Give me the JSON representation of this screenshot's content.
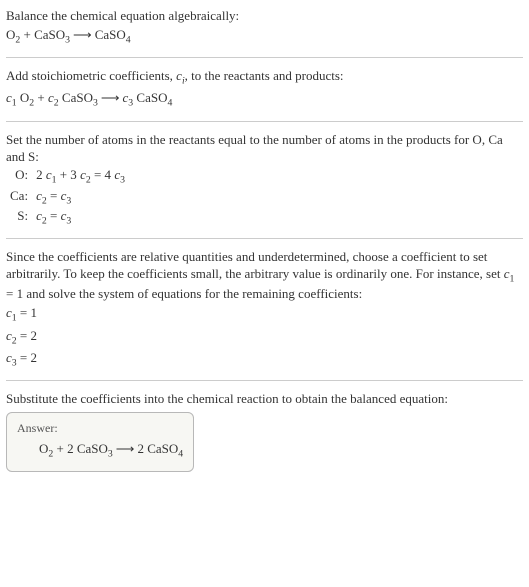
{
  "section1": {
    "title": "Balance the chemical equation algebraically:",
    "eq_lhs1": "O",
    "eq_lhs1_sub": "2",
    "eq_plus": " + ",
    "eq_lhs2": "CaSO",
    "eq_lhs2_sub": "3",
    "arrow": "⟶",
    "eq_rhs": "CaSO",
    "eq_rhs_sub": "4"
  },
  "section2": {
    "title_a": "Add stoichiometric coefficients, ",
    "title_ci_c": "c",
    "title_ci_i": "i",
    "title_b": ", to the reactants and products:",
    "c1": "c",
    "c1_sub": "1",
    "sp": " ",
    "O2": "O",
    "O2_sub": "2",
    "plus": " + ",
    "c2": "c",
    "c2_sub": "2",
    "CaSO3": "CaSO",
    "CaSO3_sub": "3",
    "arrow": "⟶",
    "c3": "c",
    "c3_sub": "3",
    "CaSO4": "CaSO",
    "CaSO4_sub": "4"
  },
  "section3": {
    "title": "Set the number of atoms in the reactants equal to the number of atoms in the products for O, Ca and S:",
    "rows": {
      "O_label": "O:",
      "O_eq_a": "2 ",
      "O_eq_c1": "c",
      "O_eq_c1_sub": "1",
      "O_eq_b": " + 3 ",
      "O_eq_c2": "c",
      "O_eq_c2_sub": "2",
      "O_eq_c": " = 4 ",
      "O_eq_c3": "c",
      "O_eq_c3_sub": "3",
      "Ca_label": "Ca:",
      "Ca_eq_c2": "c",
      "Ca_eq_c2_sub": "2",
      "Ca_eq_eq": " = ",
      "Ca_eq_c3": "c",
      "Ca_eq_c3_sub": "3",
      "S_label": "S:",
      "S_eq_c2": "c",
      "S_eq_c2_sub": "2",
      "S_eq_eq": " = ",
      "S_eq_c3": "c",
      "S_eq_c3_sub": "3"
    }
  },
  "section4": {
    "title_a": "Since the coefficients are relative quantities and underdetermined, choose a coefficient to set arbitrarily. To keep the coefficients small, the arbitrary value is ordinarily one. For instance, set ",
    "c1": "c",
    "c1_sub": "1",
    "title_b": " = 1 and solve the system of equations for the remaining coefficients:",
    "l1_c": "c",
    "l1_sub": "1",
    "l1_v": " = 1",
    "l2_c": "c",
    "l2_sub": "2",
    "l2_v": " = 2",
    "l3_c": "c",
    "l3_sub": "3",
    "l3_v": " = 2"
  },
  "section5": {
    "title": "Substitute the coefficients into the chemical reaction to obtain the balanced equation:",
    "answer_label": "Answer:",
    "O2": "O",
    "O2_sub": "2",
    "plus": " + 2 ",
    "CaSO3": "CaSO",
    "CaSO3_sub": "3",
    "arrow": "⟶",
    "rhs_pre": "2 ",
    "CaSO4": "CaSO",
    "CaSO4_sub": "4"
  },
  "chart_data": {
    "type": "table",
    "title": "Balanced chemical equation derivation",
    "unbalanced_equation": "O2 + CaSO3 ⟶ CaSO4",
    "coefficient_equation": "c1 O2 + c2 CaSO3 ⟶ c3 CaSO4",
    "atom_balance": [
      {
        "element": "O",
        "equation": "2 c1 + 3 c2 = 4 c3"
      },
      {
        "element": "Ca",
        "equation": "c2 = c3"
      },
      {
        "element": "S",
        "equation": "c2 = c3"
      }
    ],
    "solution": {
      "c1": 1,
      "c2": 2,
      "c3": 2
    },
    "balanced_equation": "O2 + 2 CaSO3 ⟶ 2 CaSO4"
  }
}
